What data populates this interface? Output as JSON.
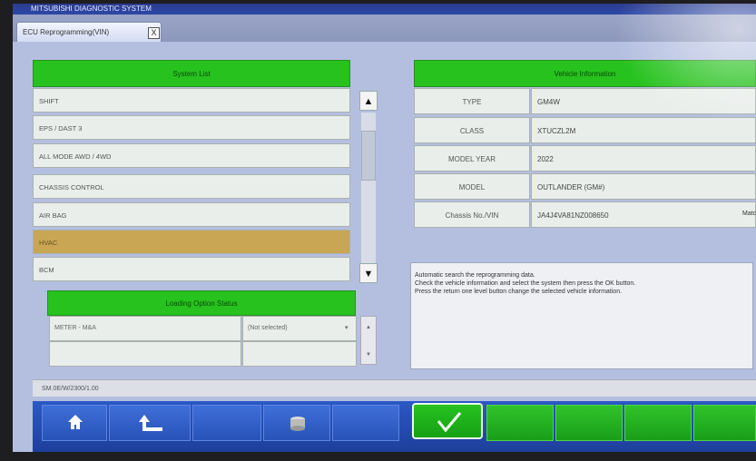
{
  "window": {
    "title": "MITSUBISHI DIAGNOSTIC SYSTEM"
  },
  "tab": {
    "label": "ECU Reprogramming(VIN)",
    "close_glyph": "X"
  },
  "system_list": {
    "title": "System List",
    "items": [
      "SHIFT",
      "EPS / DAST 3",
      "ALL MODE AWD / 4WD",
      "CHASSIS CONTROL",
      "AIR BAG",
      "HVAC",
      "BCM"
    ],
    "selected_index": 5,
    "scroll_up": "▲",
    "scroll_down": "▼"
  },
  "loading_option": {
    "title": "Loading Option Status",
    "rows": [
      {
        "name": "METER - M&A",
        "value": "(Not selected)"
      },
      {
        "name": "",
        "value": ""
      }
    ],
    "dropdown_glyph": "▾",
    "scroll_up": "▲",
    "scroll_down": "▼"
  },
  "vehicle_info": {
    "title": "Vehicle Information",
    "rows": [
      {
        "label": "TYPE",
        "value": "GM4W"
      },
      {
        "label": "CLASS",
        "value": "XTUCZL2M"
      },
      {
        "label": "MODEL YEAR",
        "value": "2022"
      },
      {
        "label": "MODEL",
        "value": "OUTLANDER (GM#)"
      },
      {
        "label": "Chassis No./VIN",
        "value": "JA4J4VA81NZ008650"
      }
    ],
    "match_label": "Match"
  },
  "message": {
    "lines": [
      "Automatic search the reprogramming data.",
      "Check the vehicle information and select the system then press the OK button.",
      "Press the return one level button change the selected vehicle information."
    ]
  },
  "status_bar": {
    "text": "SM.0E/W/2300/1.00"
  },
  "colors": {
    "header_green": "#27c21e",
    "selected_row": "#c8a654",
    "bottom_bar": "#2b59c5"
  },
  "bottom_buttons": {
    "home_icon": "home-icon",
    "back_icon": "return-icon",
    "save_icon": "data-icon",
    "ok_icon": "ok-check-icon"
  }
}
